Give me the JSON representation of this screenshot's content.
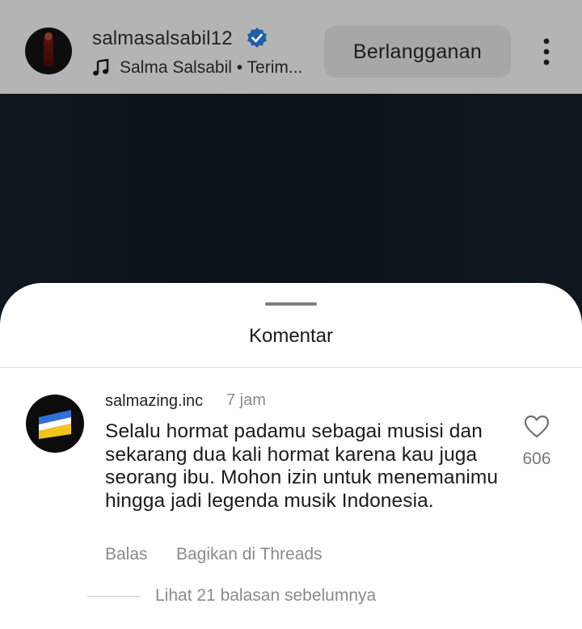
{
  "header": {
    "username": "salmasalsabil12",
    "music_text": "Salma Salsabil • Terim...",
    "subscribe_label": "Berlangganan"
  },
  "comments_sheet": {
    "title": "Komentar",
    "comment": {
      "username": "salmazing.inc",
      "time": "7 jam",
      "text": "Selalu hormat padamu sebagai musisi dan sekarang dua kali hormat karena kau juga seorang ibu. Mohon izin untuk menemanimu hingga jadi legenda musik Indonesia.",
      "like_count": "606",
      "reply_label": "Balas",
      "share_label": "Bagikan di Threads",
      "view_replies_label": "Lihat 21 balasan sebelumnya"
    }
  },
  "colors": {
    "verified_badge": "#1c6fd0",
    "avatar_blue": "#2f6fd6",
    "avatar_yellow": "#f2c31a"
  }
}
